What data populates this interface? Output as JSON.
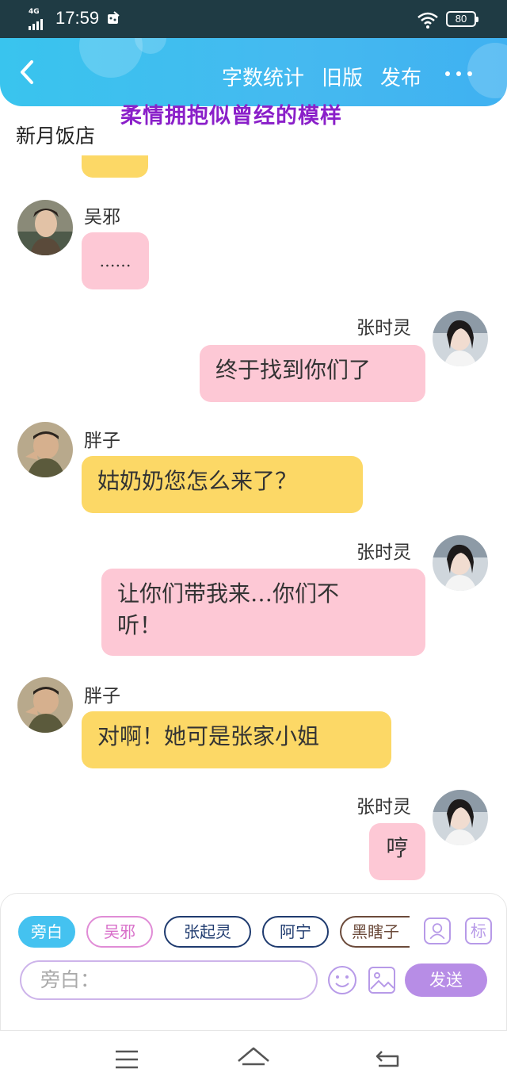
{
  "status_bar": {
    "network": "4G",
    "time": "17:59",
    "battery": "80"
  },
  "header": {
    "menu": [
      "字数统计",
      "旧版",
      "发布"
    ],
    "overlay_title": "柔情拥抱似曾经的模样"
  },
  "scene_title": "新月饭店",
  "messages": [
    {
      "speaker": "吴邪",
      "text": "……",
      "side": "left",
      "color": "pink"
    },
    {
      "speaker": "张时灵",
      "text": "终于找到你们了",
      "side": "right",
      "color": "pink"
    },
    {
      "speaker": "胖子",
      "text": "姑奶奶您怎么来了？",
      "side": "left",
      "color": "yellow"
    },
    {
      "speaker": "张时灵",
      "text_line1": "让你们带我来…你们不",
      "text_line2": "听！",
      "side": "right",
      "color": "pink"
    },
    {
      "speaker": "胖子",
      "text": "对啊！她可是张家小姐",
      "side": "left",
      "color": "yellow"
    },
    {
      "speaker": "张时灵",
      "text": "哼",
      "side": "right",
      "color": "pink"
    }
  ],
  "role_chips": [
    "旁白",
    "吴邪",
    "张起灵",
    "阿宁",
    "黑瞎子"
  ],
  "tag_button": "标",
  "input": {
    "placeholder": "旁白："
  },
  "send_label": "发送",
  "colors": {
    "header": "#3fb9f0",
    "overlay_title": "#8a1fc9",
    "bubble_yellow": "#fcd866",
    "bubble_pink": "#fdc8d5",
    "accent_purple": "#b78de6",
    "chip_active": "#44c2f0"
  },
  "icons": [
    "back-icon",
    "more-icon",
    "add-role-icon",
    "emoji-icon",
    "image-icon",
    "menu-icon",
    "home-icon",
    "return-icon"
  ]
}
